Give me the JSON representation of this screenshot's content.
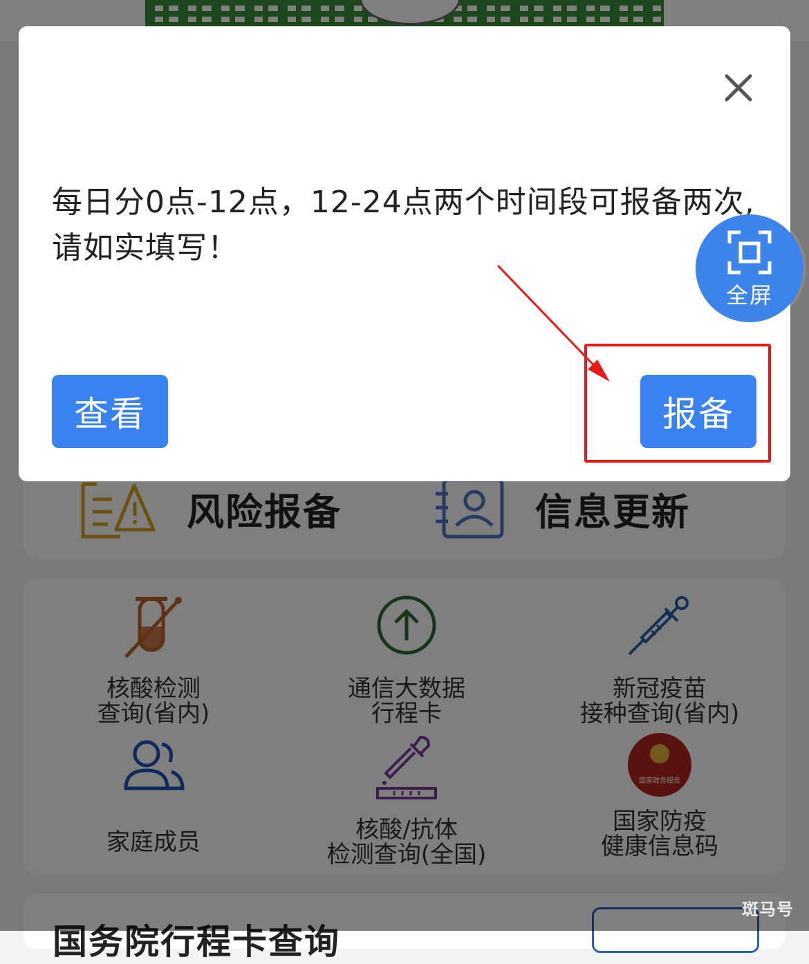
{
  "dialog": {
    "message": "每日分0点-12点，12-24点两个时间段可报备两次,请如实填写！",
    "view_button": "查看",
    "report_button": "报备"
  },
  "fullscreen": {
    "label": "全屏"
  },
  "actions": {
    "risk_report": "风险报备",
    "info_update": "信息更新"
  },
  "services": [
    {
      "label": "核酸检测\n查询(省内)",
      "icon": "test-tube-icon"
    },
    {
      "label": "通信大数据\n行程卡",
      "icon": "upload-arrow-icon"
    },
    {
      "label": "新冠疫苗\n接种查询(省内)",
      "icon": "syringe-icon"
    },
    {
      "label": "家庭成员",
      "icon": "family-icon"
    },
    {
      "label": "核酸/抗体\n检测查询(全国)",
      "icon": "dropper-icon"
    },
    {
      "label": "国家防疫\n健康信息码",
      "icon": "government-emblem-icon"
    }
  ],
  "emblem_text": "国家政务服务",
  "bottom_section": {
    "title": "国务院行程卡查询"
  },
  "watermark": "斑马号",
  "colors": {
    "primary_button": "#3a82f0",
    "fullscreen_bubble": "#3d84ea",
    "highlight": "#e81919"
  }
}
